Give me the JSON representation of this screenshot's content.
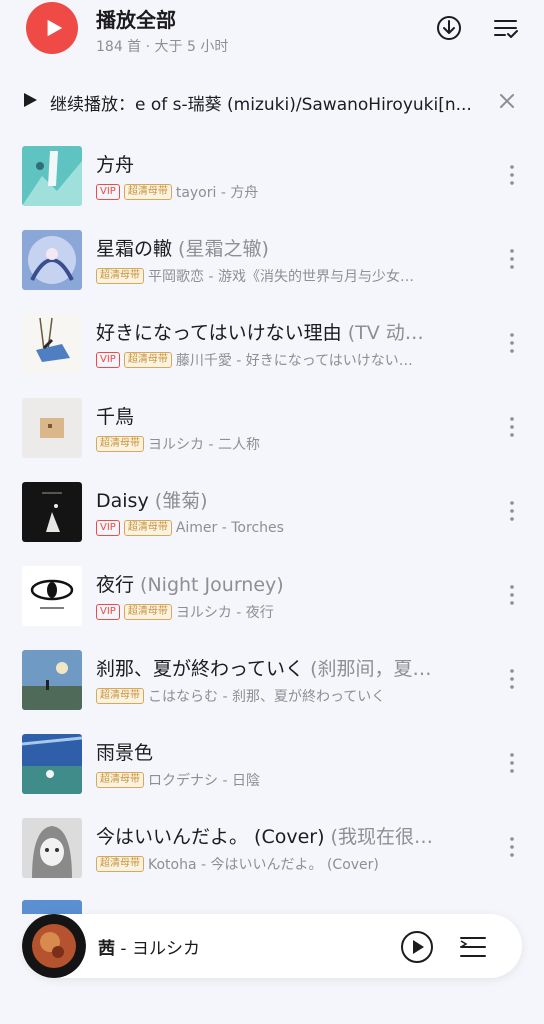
{
  "header": {
    "title": "播放全部",
    "subtitle": "184 首 · 大于 5 小时"
  },
  "resume": {
    "text": "继续播放：e of s-瑞葵 (mizuki)/SawanoHiroyuki[n..."
  },
  "songs": [
    {
      "title": "方舟",
      "alias": "",
      "vip": true,
      "hq": true,
      "artist": "tayori - 方舟"
    },
    {
      "title": "星霜の轍",
      "alias": " (星霜之辙)",
      "vip": false,
      "hq": true,
      "artist": "平岡歌恋 - 游戏《消失的世界与月与少女…"
    },
    {
      "title": "好きになってはいけない理由",
      "alias": " (TV 动…",
      "vip": true,
      "hq": true,
      "artist": "藤川千愛 - 好きになってはいけない…"
    },
    {
      "title": "千鳥",
      "alias": "",
      "vip": false,
      "hq": true,
      "artist": "ヨルシカ - 二人称"
    },
    {
      "title": "Daisy",
      "alias": " (雏菊)",
      "vip": true,
      "hq": true,
      "artist": "Aimer - Torches"
    },
    {
      "title": "夜行",
      "alias": " (Night Journey)",
      "vip": true,
      "hq": true,
      "artist": "ヨルシカ - 夜行"
    },
    {
      "title": "刹那、夏が終わっていく",
      "alias": " (刹那间，夏…",
      "vip": false,
      "hq": true,
      "artist": "こはならむ - 刹那、夏が終わっていく"
    },
    {
      "title": "雨景色",
      "alias": "",
      "vip": false,
      "hq": true,
      "artist": "ロクデナシ - 日陰"
    },
    {
      "title": "今はいいんだよ。 (Cover)",
      "alias": " (我现在很…",
      "vip": false,
      "hq": true,
      "artist": "Kotoha - 今はいいんだよ。 (Cover)"
    }
  ],
  "badges": {
    "vip": "VIP",
    "hq": "超清母带"
  },
  "mini_player": {
    "song": "茜",
    "sep": " - ",
    "artist": "ヨルシカ"
  },
  "colors": {
    "accent": "#ef4a46",
    "hq_badge": "#c8943a",
    "muted": "#8e8e93"
  }
}
